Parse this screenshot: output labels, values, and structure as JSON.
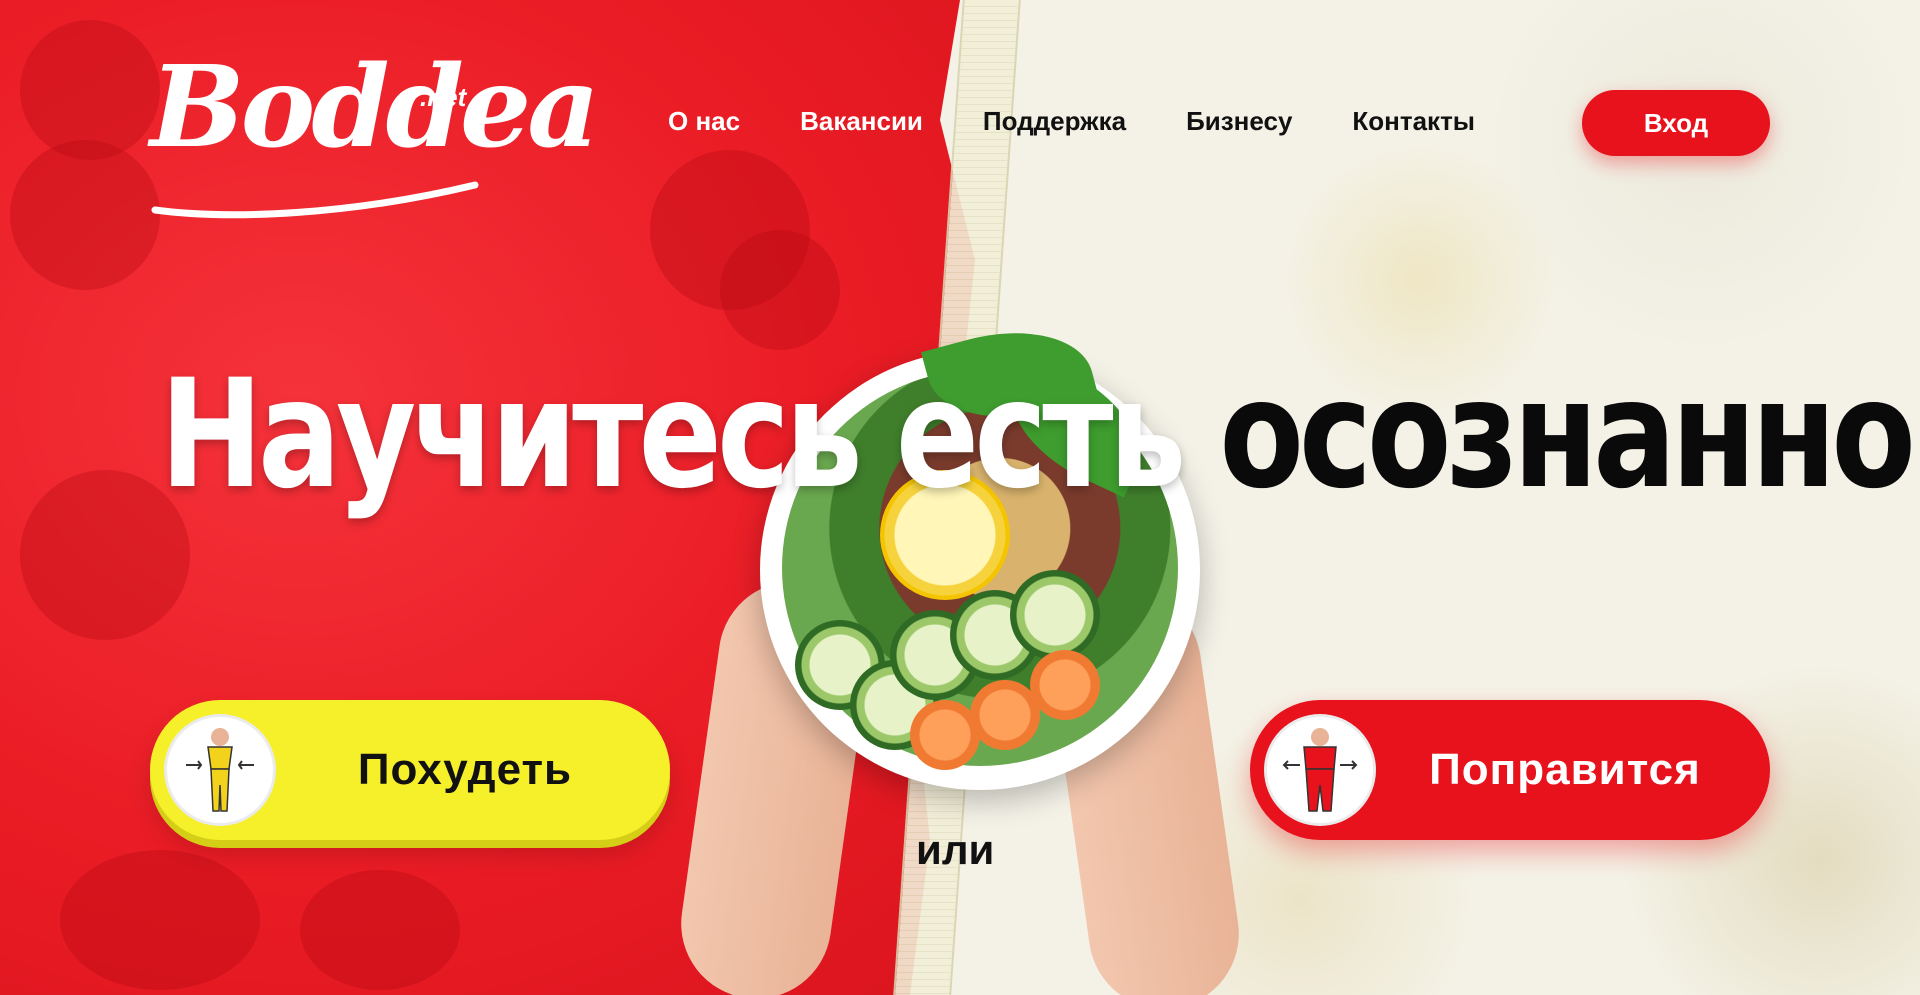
{
  "logo": {
    "main": "Boddea",
    "suffix": ".net"
  },
  "nav": {
    "items": [
      {
        "label": "О нас"
      },
      {
        "label": "Вакансии"
      },
      {
        "label": "Поддержка"
      },
      {
        "label": "Бизнесу"
      },
      {
        "label": "Контакты"
      }
    ]
  },
  "header": {
    "login_label": "Вход"
  },
  "hero": {
    "headline_light": "Научитесь есть",
    "headline_dark": "осознанно",
    "separator": "или"
  },
  "actions": {
    "lose_label": "Похудеть",
    "gain_label": "Поправится"
  },
  "colors": {
    "brand_red": "#e8121d",
    "accent_yellow": "#f6f02a",
    "text_dark": "#111111",
    "cream": "#f4f2e7"
  },
  "icons": {
    "lose_avatar": "slim-figure-icon",
    "gain_avatar": "fuller-figure-icon"
  }
}
